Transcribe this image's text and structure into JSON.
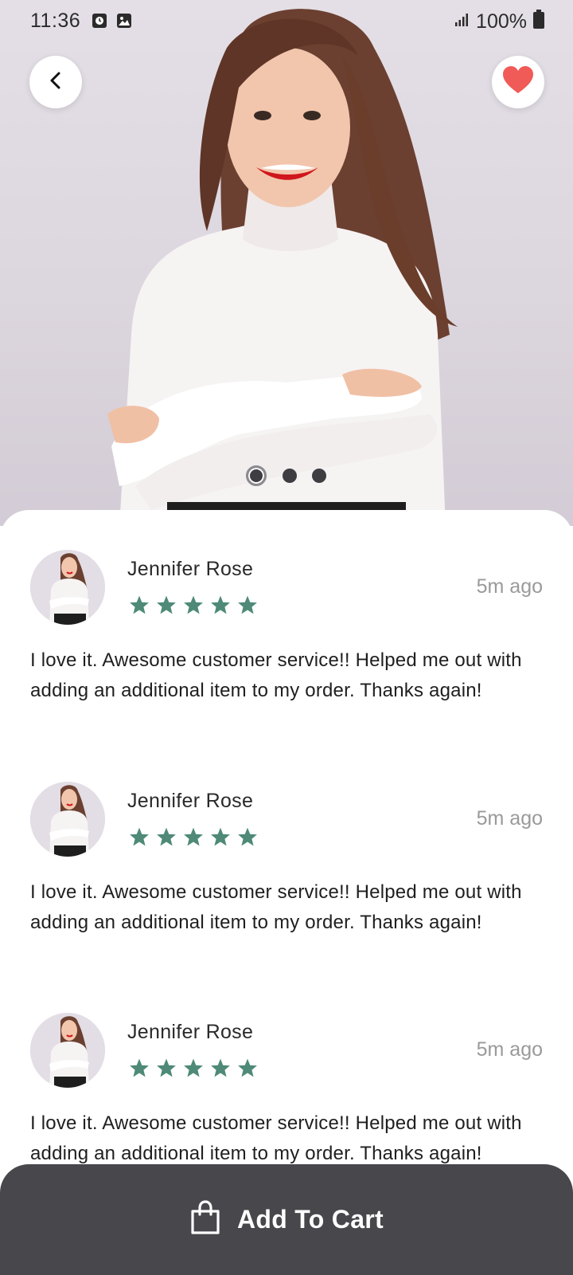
{
  "status_bar": {
    "time": "11:36",
    "battery": "100%",
    "icons": [
      "timer-notification-icon",
      "image-notification-icon",
      "signal-icon",
      "battery-icon"
    ]
  },
  "header": {
    "back_icon": "chevron-left-icon",
    "favorite_icon": "heart-icon",
    "favorite_color": "#f05a57"
  },
  "carousel": {
    "total": 3,
    "active_index": 0
  },
  "reviews": [
    {
      "name": "Jennifer Rose",
      "rating": 5,
      "time": "5m ago",
      "text": "I love it.  Awesome customer service!! Helped me out with adding an additional item to my order. Thanks again!"
    },
    {
      "name": "Jennifer Rose",
      "rating": 5,
      "time": "5m ago",
      "text": "I love it.  Awesome customer service!! Helped me out with adding an additional item to my order. Thanks again!"
    },
    {
      "name": "Jennifer Rose",
      "rating": 5,
      "time": "5m ago",
      "text": "I love it.  Awesome customer service!! Helped me out with adding an additional item to my order. Thanks again!"
    }
  ],
  "colors": {
    "star": "#4e8a77",
    "cart_bar": "#48474c"
  },
  "cart": {
    "label": "Add To Cart",
    "icon": "shopping-bag-icon"
  }
}
